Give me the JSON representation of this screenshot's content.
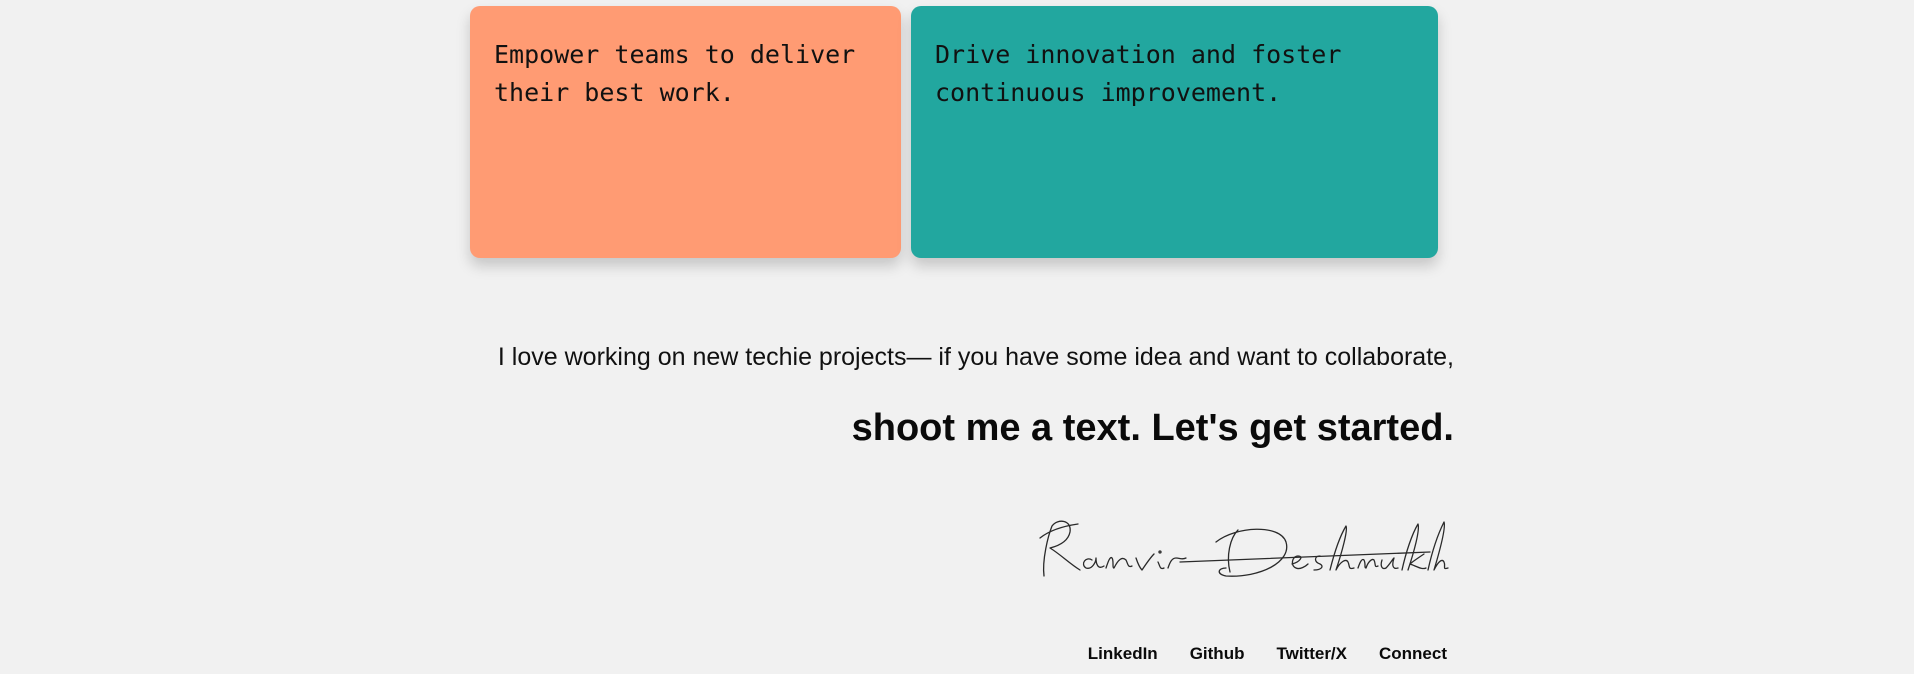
{
  "cards": [
    {
      "text": "Empower teams to deliver their best work.",
      "color": "#ff9b73"
    },
    {
      "text": "Drive innovation and foster continuous improvement.",
      "color": "#22a79f"
    }
  ],
  "intro_text": "I love working on new techie projects— if you have some idea and want to collaborate,",
  "cta_text": "shoot me a text. Let's get started.",
  "signature_text": "Ranvir Deshmukh",
  "footer": {
    "links": [
      "LinkedIn",
      "Github",
      "Twitter/X",
      "Connect"
    ]
  },
  "colors": {
    "background": "#f1f1f1",
    "card_primary": "#ff9b73",
    "card_secondary": "#22a79f"
  }
}
